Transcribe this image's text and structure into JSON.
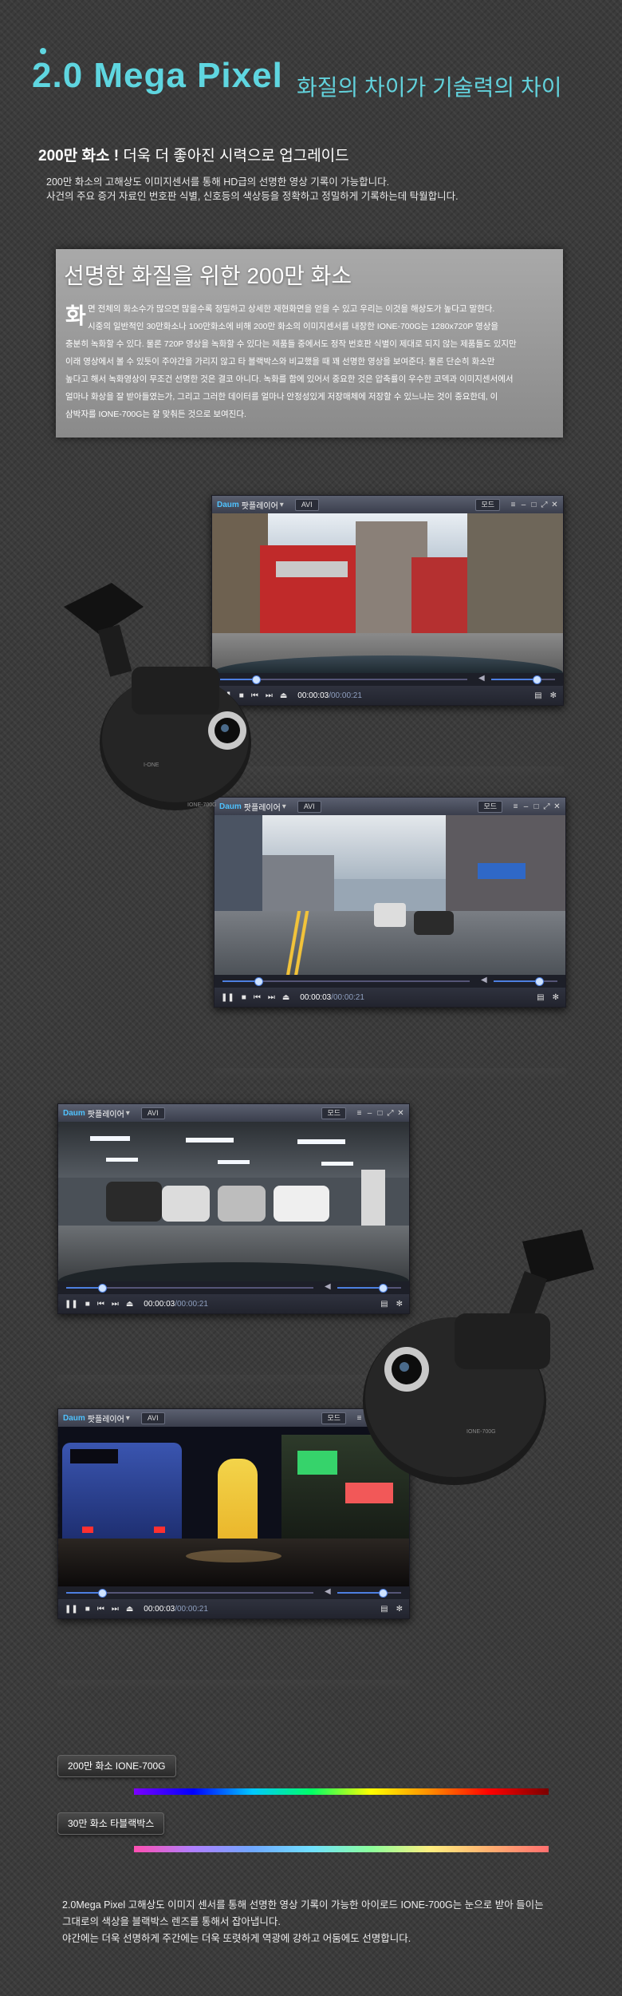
{
  "header": {
    "title": "2.0 Mega Pixel",
    "subtitle": "화질의 차이가 기술력의 차이"
  },
  "section": {
    "heading_bold": "200만 화소 !",
    "heading_rest": "더욱 더 좋아진 시력으로 업그레이드",
    "intro_lines": [
      "200만 화소의 고해상도 이미지센서를 통해 HD급의 선명한 영상 기록이 가능합니다.",
      "사건의 주요 증거 자료인 번호판 식별, 신호등의 색상등을 정확하고 정밀하게 기록하는데 탁월합니다."
    ]
  },
  "textbox": {
    "title": "선명한 화질을 위한 200만 화소",
    "initial": "화",
    "lines": [
      "면 전체의 화소수가 많으면 많을수록 정밀하고 상세한 재현화면을 얻을 수 있고 우리는 이것을 해상도가 높다고 말한다.",
      "시중의 일반적인 30만화소나 100만화소에 비해 200만 화소의 이미지센서를 내장한 IONE-700G는 1280x720P 영상을",
      "충분히 녹화할 수 있다. 물론 720P 영상을 녹화할 수 있다는 제품들 중에서도 정작 번호판 식별이 제대로 되지 않는 제품들도 있지만",
      "이래 영상에서 볼 수 있듯이 주야간을 가리지 않고 타 블랙박스와 비교했을 때 꽤 선명한 영상을 보여준다. 물론 단순히 화소만",
      "높다고 해서 녹화영상이 무조건 선명한 것은 결코 아니다. 녹화를 함에 있어서 중요한 것은 압축률이 우수한 코덱과 이미지센서에서",
      "얼마나 화상을 잘 받아들였는가, 그리고 그러한 데이터를 얼마나 안정성있게 저장매체에 저장할 수 있느냐는 것이 중요한데, 이",
      "삼박자를 IONE-700G는 잘 맞춰든 것으로 보여진다."
    ]
  },
  "player": {
    "app_name": "팟플레이어",
    "logo_a": "Daum",
    "format": "AVI",
    "mode": "모드",
    "time_current": "00:00:03",
    "time_sep": " / ",
    "time_total": "00:00:21",
    "seek_progress": 0.14,
    "volume_level": 0.68
  },
  "dashcam": {
    "brand_left": "I-ONE",
    "brand_right": "IONE-700G"
  },
  "compare": {
    "tag_a": "200만 화소 IONE-700G",
    "tag_b": "30만 화소 타블랙박스"
  },
  "footer": {
    "lines": [
      "2.0Mega Pixel 고해상도 이미지 센서를 통해 선명한 영상 기록이 가능한 아이로드 IONE-700G는 눈으로 받아 들이는",
      "그대로의 색상을 블랙박스 렌즈를 통해서 잡아냅니다.",
      "야간에는 더욱 선명하게 주간에는 더욱 또렷하게 역광에 강하고 어둠에도 선명합니다."
    ]
  }
}
